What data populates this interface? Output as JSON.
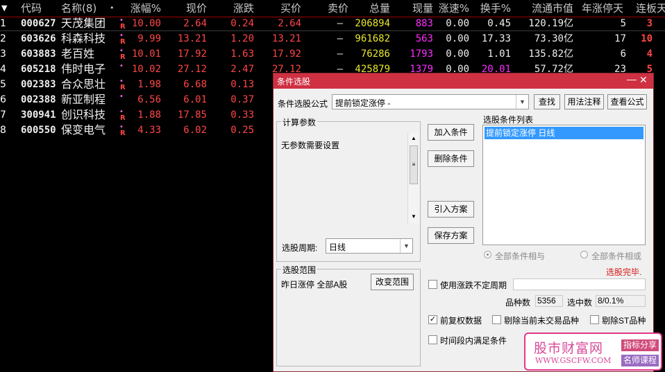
{
  "table": {
    "headers": {
      "arrow": "▼",
      "code": "代码",
      "name": "名称(8)",
      "dot": "•",
      "change_pct": "涨幅%",
      "price": "现价",
      "change": "涨跌",
      "bid": "买价",
      "ask": "卖价",
      "volume": "总量",
      "cur_vol": "现量",
      "speed": "涨速%",
      "turnover": "换手%",
      "float_cap": "流通市值",
      "year_limit_days": "年涨停天",
      "consecutive": "连板天"
    },
    "rows": [
      {
        "idx": "1",
        "code": "000627",
        "name": "天茂集团",
        "flag": "R",
        "change_pct": "10.00",
        "price": "2.64",
        "change": "0.24",
        "bid": "2.64",
        "ask": "—",
        "volume": "206894",
        "cur_vol": "883",
        "speed": "0.00",
        "turnover": "0.45",
        "float_cap": "120.19亿",
        "year_limit_days": "5",
        "consecutive": "3"
      },
      {
        "idx": "2",
        "code": "603626",
        "name": "科森科技",
        "flag": "R",
        "change_pct": "9.99",
        "price": "13.21",
        "change": "1.20",
        "bid": "13.21",
        "ask": "—",
        "volume": "961682",
        "cur_vol": "563",
        "speed": "0.00",
        "turnover": "17.33",
        "float_cap": "73.30亿",
        "year_limit_days": "17",
        "consecutive": "10"
      },
      {
        "idx": "3",
        "code": "603883",
        "name": "老百姓",
        "flag": "R",
        "change_pct": "10.01",
        "price": "17.92",
        "change": "1.63",
        "bid": "17.92",
        "ask": "—",
        "volume": "76286",
        "cur_vol": "1793",
        "speed": "0.00",
        "turnover": "1.01",
        "float_cap": "135.82亿",
        "year_limit_days": "6",
        "consecutive": "4"
      },
      {
        "idx": "4",
        "code": "605218",
        "name": "伟时电子",
        "flag": "",
        "change_pct": "10.02",
        "price": "27.12",
        "change": "2.47",
        "bid": "27.12",
        "ask": "—",
        "volume": "425879",
        "cur_vol": "1379",
        "speed": "0.00",
        "turnover": "20.01",
        "float_cap": "57.72亿",
        "year_limit_days": "23",
        "consecutive": "5"
      },
      {
        "idx": "5",
        "code": "002383",
        "name": "合众思壮",
        "flag": "R",
        "change_pct": "1.98",
        "price": "6.68",
        "change": "0.13"
      },
      {
        "idx": "6",
        "code": "002388",
        "name": "新亚制程",
        "flag": "",
        "change_pct": "6.56",
        "price": "6.01",
        "change": "0.37"
      },
      {
        "idx": "7",
        "code": "300941",
        "name": "创识科技",
        "flag": "R",
        "change_pct": "1.88",
        "price": "17.85",
        "change": "0.33"
      },
      {
        "idx": "8",
        "code": "600550",
        "name": "保变电气",
        "flag": "R",
        "change_pct": "4.33",
        "price": "6.02",
        "change": "0.25"
      }
    ]
  },
  "dialog": {
    "title": "条件选股",
    "min_icon": "—",
    "close_icon": "✕",
    "formula_label": "条件选股公式",
    "formula_value": "提前锁定涨停  -",
    "buttons": {
      "find": "查找",
      "usage": "用法注释",
      "view": "查看公式",
      "add": "加入条件",
      "delete": "删除条件",
      "import": "引入方案",
      "save": "保存方案",
      "change_range": "改变范围"
    },
    "params_group": "计算参数",
    "params_text": "无参数需要设置",
    "period_label": "选股周期:",
    "period_value": "日线",
    "list_label": "选股条件列表",
    "list_items": [
      "提前锁定涨停  日线"
    ],
    "radio_and": "全部条件相与",
    "radio_or": "全部条件相或",
    "status": "选股完毕.",
    "range_group": "选股范围",
    "range_text": "昨日涨停 全部A股",
    "use_period_label": "使用涨跌不定周期",
    "count_label": "品种数",
    "count_value": "5356",
    "selected_label": "选中数",
    "selected_value": "8/0.1%",
    "chk_adjust": "前复权数据",
    "chk_adjust_checked": true,
    "chk_untraded": "剔除当前未交易品种",
    "chk_st": "剔除ST品种",
    "chk_timespan": "时间段内满足条件"
  },
  "watermark": {
    "title": "股市财富网",
    "url": "WWW.GSCFW.COM",
    "tag1": "指标分享",
    "tag2": "名师课程"
  }
}
